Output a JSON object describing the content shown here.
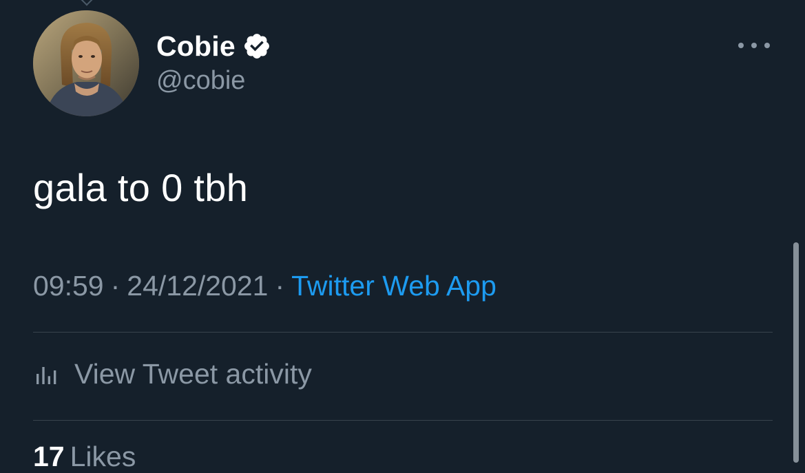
{
  "user": {
    "display_name": "Cobie",
    "handle": "@cobie",
    "verified_icon": "verified-badge-icon"
  },
  "tweet": {
    "text": "gala to 0 tbh",
    "time": "09:59",
    "date": "24/12/2021",
    "separator": "·",
    "source": "Twitter Web App"
  },
  "activity": {
    "label": "View Tweet activity",
    "icon": "bar-chart-icon"
  },
  "stats": {
    "likes_count": "17",
    "likes_label": "Likes"
  },
  "colors": {
    "background": "#15202b",
    "primary_text": "#ffffff",
    "secondary_text": "#8b98a5",
    "link": "#1d9bf0",
    "divider": "#38444d"
  }
}
